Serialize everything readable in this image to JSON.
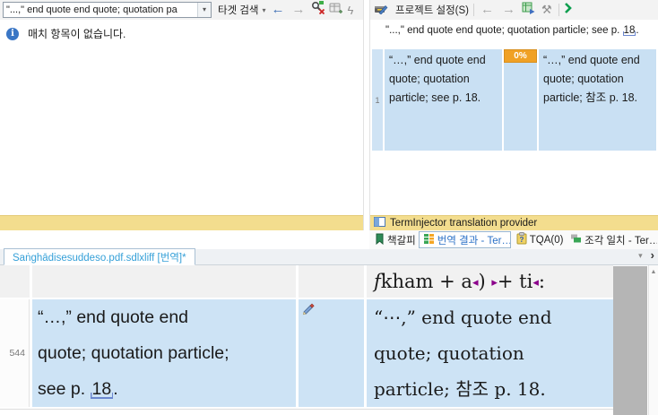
{
  "colors": {
    "segment_highlight": "#CDE3F5",
    "tm_cell_blue": "#C9E0F3",
    "match_score_bg": "#F0A125",
    "provider_bar_bg": "#F3DD8E",
    "tag_purple": "#8B008B",
    "selected_tab_text": "#2B71C7",
    "doc_tab_text": "#35A0D8"
  },
  "icons": {
    "dropdown": "▾",
    "mini_caret": "▾",
    "back_arrow": "←",
    "forward_arrow": "→",
    "lightning": "ϟ",
    "wrench": "⚒",
    "overflow_down": "▾",
    "overflow_next": "›",
    "scroll_up": "▲",
    "info": "i"
  },
  "search_pane": {
    "query": "\"...,\" end quote end quote; quotation pa",
    "target_search_label": "타겟 검색",
    "no_match_message": "매치 항목이 없습니다."
  },
  "results_pane": {
    "project_settings_label": "프로젝트 설정(S)",
    "lookup_line": {
      "text": "\"...,\" end quote end quote; quotation particle; see p. ",
      "page": "18",
      "period": "."
    },
    "match": {
      "row_number": "1",
      "score": "0%",
      "source": "“…,” end quote end quote; quotation particle; see p. 18.",
      "target": "“…,” end quote end quote; quotation particle; 참조 p. 18."
    },
    "provider_banner": "TermInjector translation provider",
    "tabs": [
      {
        "label": "책갈피"
      },
      {
        "label": "번역 결과 - Ter…"
      },
      {
        "label": "TQA(0)"
      },
      {
        "label": "조각 일치 - Ter…"
      }
    ]
  },
  "editor": {
    "document_tab_label": "Saṅghādisesuddeso.pdf.sdlxliff [번역]*",
    "previous_segment_target_parts": [
      {
        "v": "f"
      },
      {
        "v": "kham + a"
      },
      {
        "v": "◂"
      },
      {
        "v": ") "
      },
      {
        "v": "▸"
      },
      {
        "v": "+ ti"
      },
      {
        "v": "◂"
      },
      {
        "v": ":"
      }
    ],
    "segment": {
      "number": "544",
      "source_line1": "“…,” end quote end",
      "source_line2": "quote; quotation particle;",
      "source_line3_prefix": "see p. ",
      "source_page": "18",
      "source_period": ".",
      "target_line1": "“⋯,” end quote end",
      "target_line2": "quote; quotation",
      "target_line3": "particle; 참조 p. 18."
    }
  }
}
